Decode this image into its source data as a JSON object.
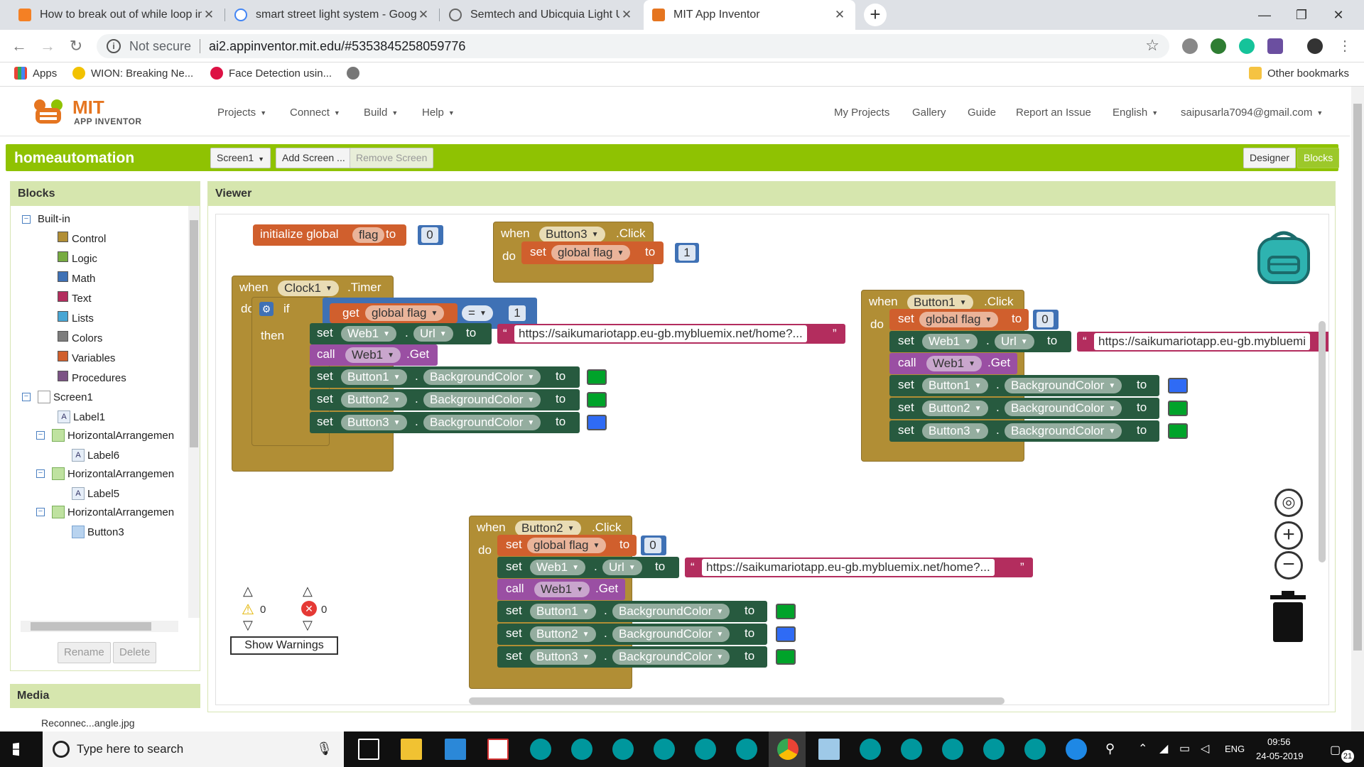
{
  "browser": {
    "tabs": [
      {
        "title": "How to break out of while loop in",
        "active": false
      },
      {
        "title": "smart street light system - Googl",
        "active": false
      },
      {
        "title": "Semtech and Ubicquia Light Up t",
        "active": false
      },
      {
        "title": "MIT App Inventor",
        "active": true
      }
    ],
    "security": "Not secure",
    "url": "ai2.appinventor.mit.edu/#5353845258059776",
    "bookmarks": [
      "Apps",
      "WION: Breaking Ne...",
      "Face Detection usin...",
      "Other bookmarks"
    ]
  },
  "header": {
    "logo_top": "MIT",
    "logo_bottom": "APP INVENTOR",
    "menus": [
      "Projects",
      "Connect",
      "Build",
      "Help"
    ],
    "links": [
      "My Projects",
      "Gallery",
      "Guide",
      "Report an Issue",
      "English",
      "saipusarla7094@gmail.com"
    ]
  },
  "project": {
    "name": "homeautomation",
    "screen": "Screen1",
    "add_screen": "Add Screen ...",
    "remove_screen": "Remove Screen",
    "designer": "Designer",
    "blocks": "Blocks"
  },
  "blocks_panel": {
    "title": "Blocks",
    "builtin": "Built-in",
    "categories": [
      {
        "name": "Control",
        "color": "#b18e35"
      },
      {
        "name": "Logic",
        "color": "#77ab41"
      },
      {
        "name": "Math",
        "color": "#3f71b5"
      },
      {
        "name": "Text",
        "color": "#b32d5e"
      },
      {
        "name": "Lists",
        "color": "#49a6d4"
      },
      {
        "name": "Colors",
        "color": "#7d7d7d"
      },
      {
        "name": "Variables",
        "color": "#d05f2d"
      },
      {
        "name": "Procedures",
        "color": "#7c5385"
      }
    ],
    "components": [
      "Screen1",
      "Label1",
      "HorizontalArrangemen",
      "Label6",
      "HorizontalArrangemen",
      "Label5",
      "HorizontalArrangemen",
      "Button3"
    ],
    "rename": "Rename",
    "delete": "Delete"
  },
  "media": {
    "title": "Media",
    "file": "Reconnec...angle.jpg"
  },
  "viewer": {
    "title": "Viewer",
    "kw": {
      "when": "when",
      "do": "do",
      "set": "set",
      "to": "to",
      "call": "call",
      "get": "get",
      "if": "if",
      "then": "then",
      "dot": ".",
      "initialize_global": "initialize global",
      "click": ".Click",
      "timer": ".Timer",
      "get_method": ".Get",
      "url": "Url",
      "bg": "BackgroundColor",
      "eq": "="
    },
    "names": {
      "flag": "flag",
      "global_flag": "global flag",
      "clock1": "Clock1",
      "button1": "Button1",
      "button2": "Button2",
      "button3": "Button3",
      "web1": "Web1"
    },
    "values": {
      "zero": "0",
      "one": "1",
      "url_short": "https://saikumariotapp.eu-gb.mybluemix.net/home?...",
      "url_cut": "https://saikumariotapp.eu-gb.mybluemi"
    },
    "colors": {
      "green": "#00a32a",
      "blue": "#2f6bf5"
    },
    "warnings_count": "0",
    "errors_count": "0",
    "show_warnings": "Show Warnings"
  },
  "taskbar": {
    "search_placeholder": "Type here to search",
    "language": "ENG",
    "time": "09:56",
    "date": "24-05-2019",
    "notifications": "21"
  }
}
